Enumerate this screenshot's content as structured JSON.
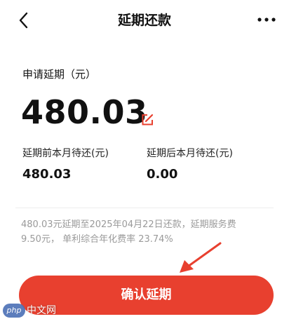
{
  "header": {
    "title": "延期还款",
    "back_icon": "chevron-left-icon",
    "more_icon": "more-dots-icon"
  },
  "apply": {
    "label": "申请延期（元）",
    "amount": "480.03",
    "edit_icon": "edit-icon"
  },
  "summary": {
    "before_label": "延期前本月待还(元)",
    "before_value": "480.03",
    "after_label": "延期后本月待还(元)",
    "after_value": "0.00"
  },
  "note": {
    "line1": "480.03元延期至2025年04月22日还款，延期服务费",
    "line2": "9.50元， 单利综合年化费率 23.74%"
  },
  "confirm_button": {
    "label": "确认延期"
  },
  "watermark": {
    "logo_text": "php",
    "text": "中文网"
  },
  "colors": {
    "accent": "#e8402f",
    "arrow": "#e8402f",
    "note_text": "#9a9a9a"
  }
}
